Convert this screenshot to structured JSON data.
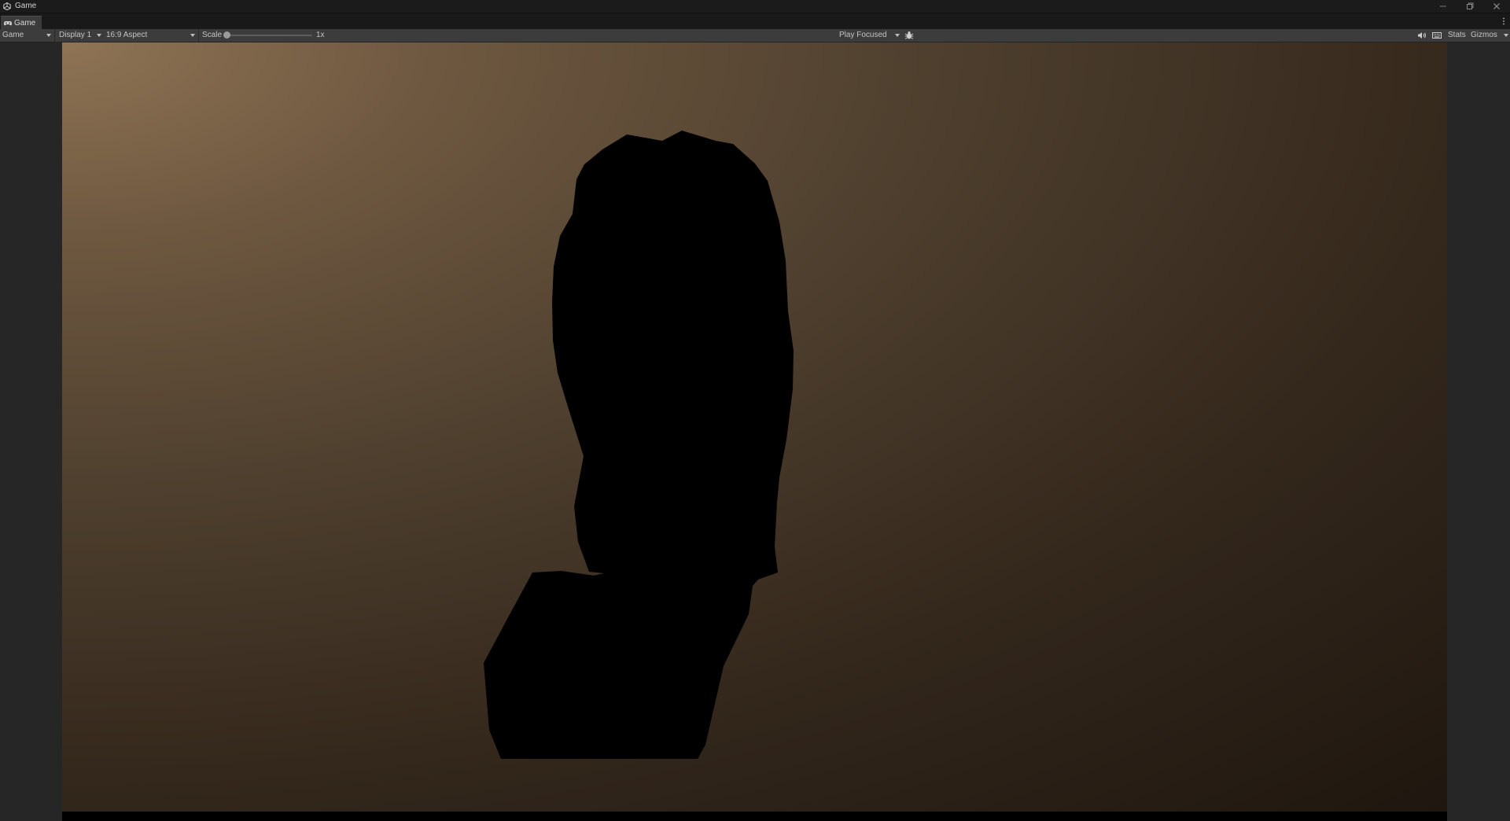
{
  "window": {
    "title": "Game",
    "controls": [
      "minimize-icon",
      "restore-icon",
      "close-icon"
    ]
  },
  "tab": {
    "label": "Game",
    "icon": "gamepad-icon"
  },
  "toolbar": {
    "view_mode": "Game",
    "display": "Display 1",
    "aspect": "16:9 Aspect",
    "scale_label": "Scale",
    "scale_value": "1x",
    "play_mode": "Play Focused",
    "stats_label": "Stats",
    "gizmos_label": "Gizmos"
  },
  "colors": {
    "background_light": "#8f7455",
    "background_dark": "#1d150e",
    "silhouette": "#000000",
    "toolbar": "#3c3c3c"
  }
}
